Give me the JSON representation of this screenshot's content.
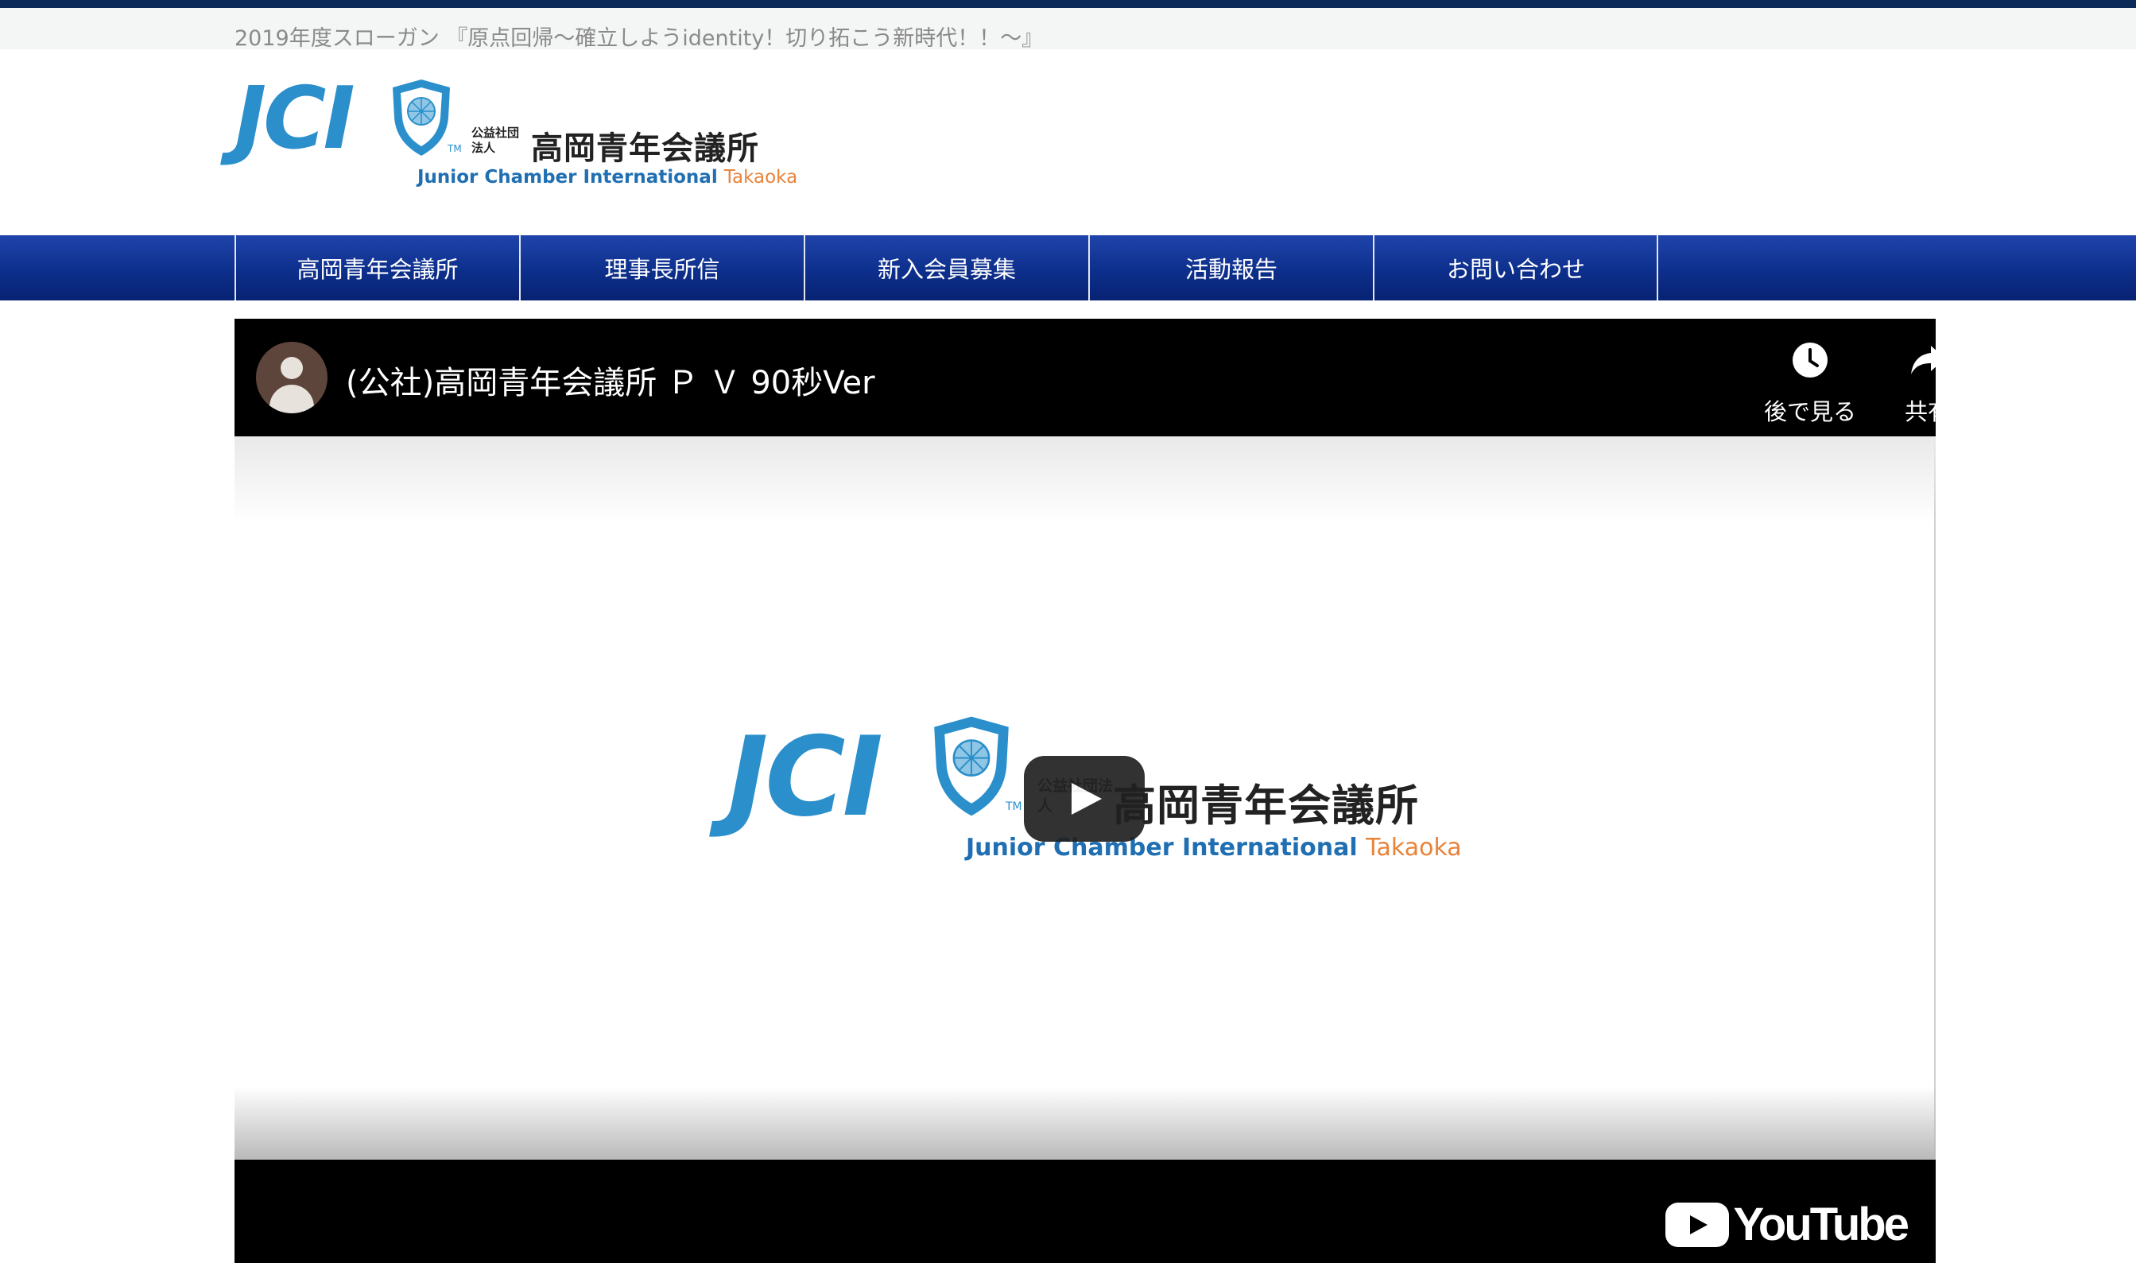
{
  "header": {
    "slogan": "2019年度スローガン 『原点回帰～確立しようidentity！切り拓こう新時代！！～』",
    "logo": {
      "mark": "JCI",
      "tm": "TM",
      "corp_type": "公益社団法人",
      "org_name": "高岡青年会議所",
      "subtitle": "Junior Chamber International",
      "subtitle_city": "Takaoka"
    }
  },
  "nav": {
    "items": [
      {
        "label": "高岡青年会議所"
      },
      {
        "label": "理事長所信"
      },
      {
        "label": "新入会員募集"
      },
      {
        "label": "活動報告"
      },
      {
        "label": "お問い合わせ"
      }
    ]
  },
  "player": {
    "title": "(公社)高岡青年会議所 Ｐ Ｖ 90秒Ver",
    "watch_later": {
      "label": "後で見る",
      "icon": "clock-icon"
    },
    "share": {
      "label": "共有",
      "icon": "share-arrow-icon"
    },
    "play_icon": "play-icon",
    "brand": "YouTube"
  },
  "colors": {
    "top_line": "#0c2a57",
    "nav_blue": "#0d2f8c",
    "jci_blue": "#2a8fcb",
    "takaoka_orange": "#e8833a"
  }
}
